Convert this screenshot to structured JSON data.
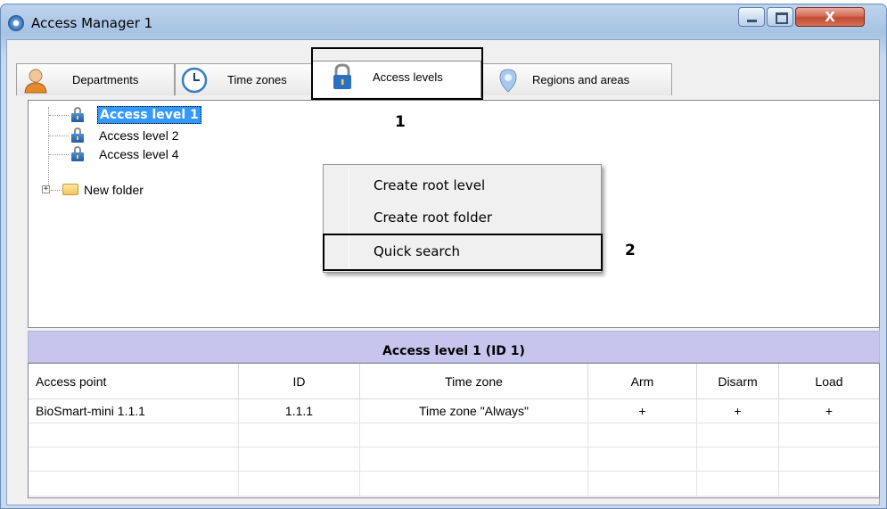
{
  "window": {
    "title": "Access Manager 1",
    "close_glyph": "X"
  },
  "tabs": [
    {
      "label": "Departments",
      "icon": "person-icon"
    },
    {
      "label": "Time zones",
      "icon": "clock-icon"
    },
    {
      "label": "Access levels",
      "icon": "lock-icon",
      "active": true
    },
    {
      "label": "Regions and areas",
      "icon": "pin-icon"
    }
  ],
  "tree": {
    "items": [
      {
        "label": "Access level 1",
        "selected": true,
        "icon": "lock-icon"
      },
      {
        "label": "Access level 2",
        "icon": "lock-icon"
      },
      {
        "label": "Access level 4",
        "icon": "lock-icon"
      },
      {
        "label": "New folder",
        "icon": "folder-icon",
        "expander": "+"
      }
    ]
  },
  "context_menu": {
    "items": [
      "Create root level",
      "Create root folder",
      "Quick search"
    ]
  },
  "callouts": {
    "one": "1",
    "two": "2"
  },
  "details": {
    "header": "Access level 1 (ID 1)",
    "columns": [
      "Access point",
      "ID",
      "Time zone",
      "Arm",
      "Disarm",
      "Load"
    ],
    "rows": [
      [
        "BioSmart-mini 1.1.1",
        "1.1.1",
        "Time zone \"Always\"",
        "+",
        "+",
        "+"
      ]
    ]
  },
  "colors": {
    "selection": "#3399ff",
    "header_band": "#c5c5ed",
    "title_gradient": "#bcd3ec"
  }
}
